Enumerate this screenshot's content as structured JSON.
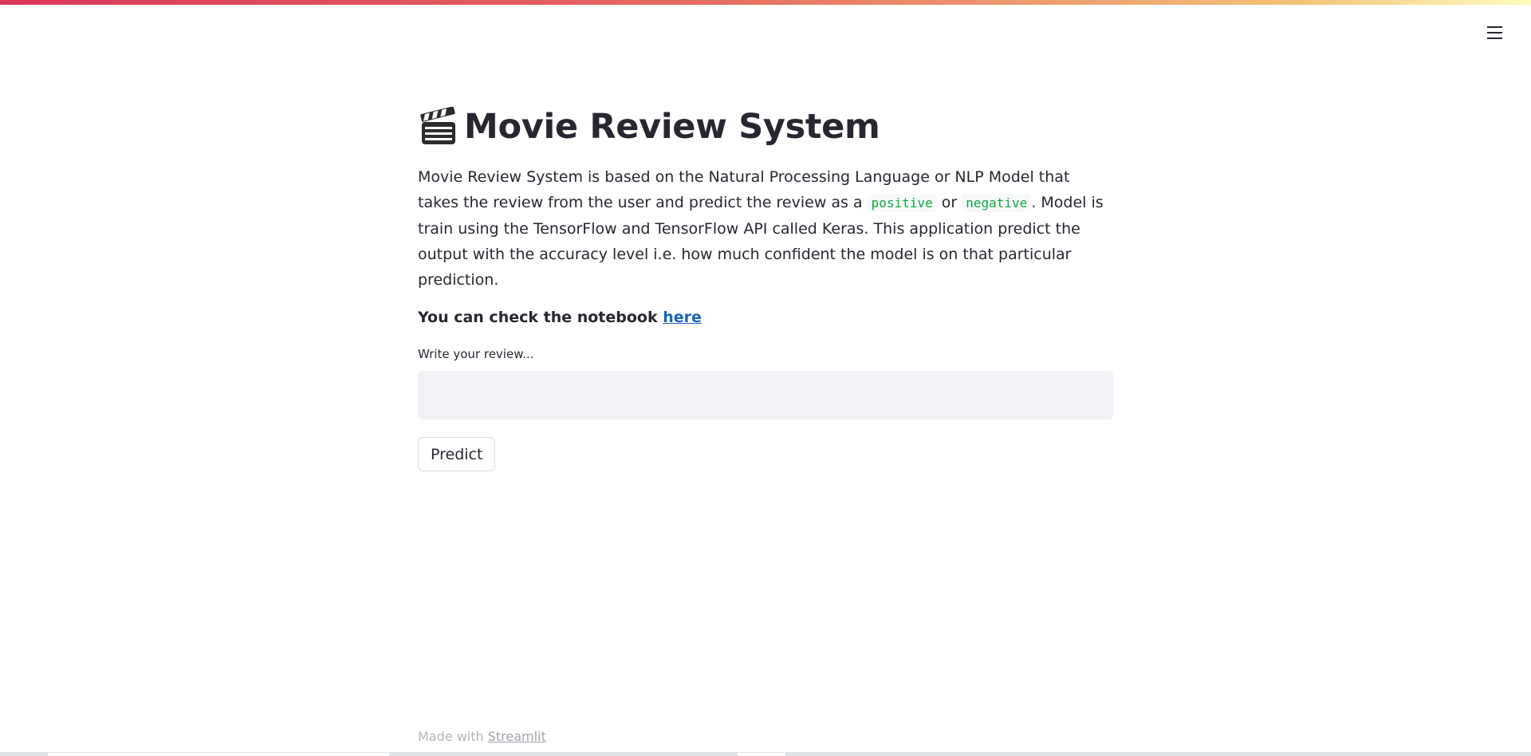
{
  "header": {
    "menu_icon": "hamburger-icon",
    "accent_gradient": [
      "#d9385a",
      "#e56a5f",
      "#f3c27a",
      "#fffdbf"
    ]
  },
  "main": {
    "title_icon": "clapper-board-icon",
    "title": "Movie Review System",
    "description": {
      "part1": "Movie Review System is based on the Natural Processing Language or NLP Model that takes the review from the user and predict the review as a ",
      "code1": "positive",
      "part2": " or ",
      "code2": "negative",
      "part3": ". Model is train using the TensorFlow and TensorFlow API called Keras. This application predict the output with the accuracy level i.e. how much confident the model is on that particular prediction."
    },
    "notebook_text": "You can check the notebook ",
    "notebook_link": "here",
    "input_label": "Write your review...",
    "input_value": "",
    "predict_label": "Predict"
  },
  "footer": {
    "made_with": "Made with ",
    "link": "Streamlit"
  },
  "colors": {
    "text": "#262730",
    "code": "#09ab3b",
    "link": "#1764c0",
    "input_bg": "#f0f2f6"
  }
}
